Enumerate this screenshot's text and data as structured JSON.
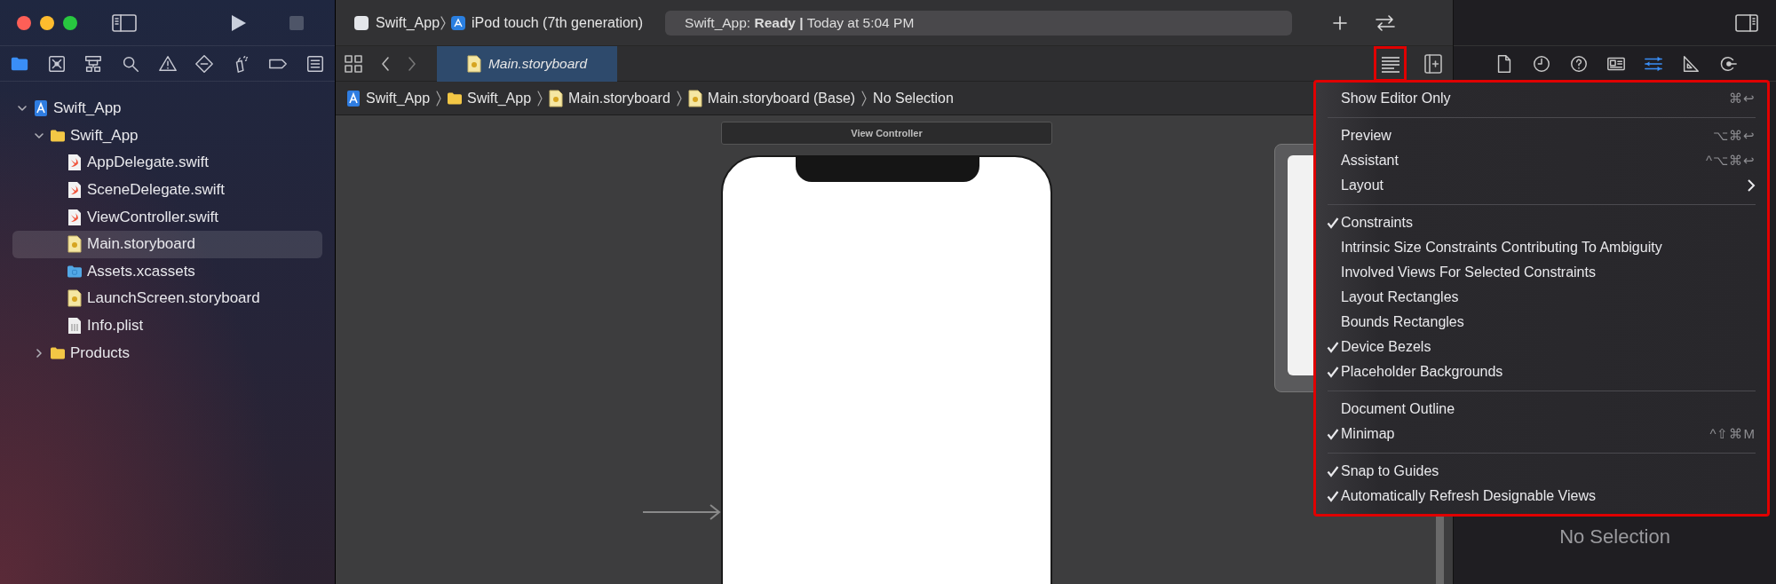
{
  "toolbar": {
    "scheme": {
      "label": "Swift_App"
    },
    "device": {
      "label": "iPod touch (7th generation)"
    },
    "status": "Swift_App: **Ready |** Today at 5:04 PM"
  },
  "navigator": {
    "tabs": [
      {
        "kind": "folder",
        "selected": true
      },
      {
        "kind": "source-control",
        "selected": false
      },
      {
        "kind": "hierarchy",
        "selected": false
      },
      {
        "kind": "search",
        "selected": false
      },
      {
        "kind": "warning",
        "selected": false
      },
      {
        "kind": "breakpoint",
        "selected": false
      },
      {
        "kind": "test",
        "selected": false
      },
      {
        "kind": "tag",
        "selected": false
      },
      {
        "kind": "report",
        "selected": false
      }
    ],
    "tree": [
      {
        "label": "Swift_App",
        "kind": "project",
        "expanded": true,
        "selected": false,
        "children": [
          {
            "label": "Swift_App",
            "kind": "folder",
            "expanded": true,
            "selected": false,
            "children": [
              {
                "label": "AppDelegate.swift",
                "kind": "swift",
                "selected": false
              },
              {
                "label": "SceneDelegate.swift",
                "kind": "swift",
                "selected": false
              },
              {
                "label": "ViewController.swift",
                "kind": "swift",
                "selected": false
              },
              {
                "label": "Main.storyboard",
                "kind": "storyboard",
                "selected": true
              },
              {
                "label": "Assets.xcassets",
                "kind": "assets",
                "selected": false
              },
              {
                "label": "LaunchScreen.storyboard",
                "kind": "storyboard",
                "selected": false
              },
              {
                "label": "Info.plist",
                "kind": "plist",
                "selected": false
              }
            ]
          },
          {
            "label": "Products",
            "kind": "folder",
            "expanded": false,
            "selected": false
          }
        ]
      }
    ]
  },
  "editor": {
    "tabs": [
      {
        "label": "Main.storyboard",
        "kind": "storyboard",
        "selected": true
      }
    ],
    "options_button": {
      "highlighted": true
    },
    "breadcrumb": [
      {
        "label": "Swift_App",
        "kind": "project"
      },
      {
        "label": "Swift_App",
        "kind": "folder"
      },
      {
        "label": "Main.storyboard",
        "kind": "storyboard"
      },
      {
        "label": "Main.storyboard (Base)",
        "kind": "storyboard"
      },
      {
        "label": "No Selection"
      }
    ],
    "canvas": {
      "scene_title": "View Controller"
    }
  },
  "menu": {
    "highlighted": true,
    "sections": [
      {
        "items": [
          {
            "label": "Show Editor Only",
            "checked": false,
            "shortcut": "⌘↩",
            "submenu": false
          }
        ]
      },
      {
        "items": [
          {
            "label": "Preview",
            "checked": false,
            "shortcut": "⌥⌘↩",
            "submenu": false
          },
          {
            "label": "Assistant",
            "checked": false,
            "shortcut": "^⌥⌘↩",
            "submenu": false
          },
          {
            "label": "Layout",
            "checked": false,
            "submenu": true
          }
        ]
      },
      {
        "items": [
          {
            "label": "Constraints",
            "checked": true,
            "submenu": false
          },
          {
            "label": "Intrinsic Size Constraints Contributing To Ambiguity",
            "checked": false,
            "submenu": false
          },
          {
            "label": "Involved Views For Selected Constraints",
            "checked": false,
            "submenu": false
          },
          {
            "label": "Layout Rectangles",
            "checked": false,
            "submenu": false
          },
          {
            "label": "Bounds Rectangles",
            "checked": false,
            "submenu": false
          },
          {
            "label": "Device Bezels",
            "checked": true,
            "submenu": false
          },
          {
            "label": "Placeholder Backgrounds",
            "checked": true,
            "submenu": false
          }
        ]
      },
      {
        "items": [
          {
            "label": "Document Outline",
            "checked": false,
            "submenu": false
          },
          {
            "label": "Minimap",
            "checked": true,
            "shortcut": "^⇧⌘M",
            "submenu": false
          }
        ]
      },
      {
        "items": [
          {
            "label": "Snap to Guides",
            "checked": true,
            "submenu": false
          },
          {
            "label": "Automatically Refresh Designable Views",
            "checked": true,
            "submenu": false
          }
        ]
      }
    ]
  },
  "inspector": {
    "tabs": [
      {
        "kind": "file",
        "selected": false
      },
      {
        "kind": "history",
        "selected": false
      },
      {
        "kind": "help",
        "selected": false
      },
      {
        "kind": "identity",
        "selected": false
      },
      {
        "kind": "attributes",
        "selected": true
      },
      {
        "kind": "size",
        "selected": false
      },
      {
        "kind": "connections",
        "selected": false
      }
    ],
    "empty_text": "No Selection"
  }
}
